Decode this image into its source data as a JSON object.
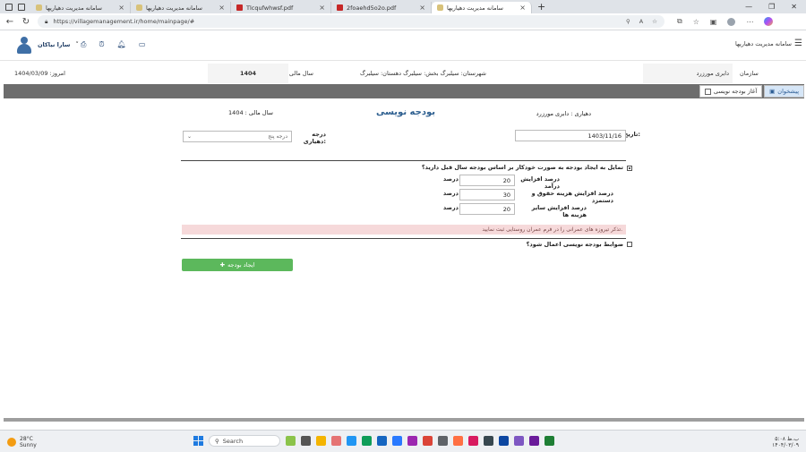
{
  "browser": {
    "tabs": [
      {
        "label": "سامانه مدیریت دهیاریها",
        "icon": "site",
        "active": false
      },
      {
        "label": "سامانه مدیریت دهیاریها",
        "icon": "site",
        "active": false
      },
      {
        "label": "Tlcqufwhwsf.pdf",
        "icon": "pdf",
        "active": false
      },
      {
        "label": "2foaehd5o2o.pdf",
        "icon": "pdf",
        "active": false
      },
      {
        "label": "سامانه مدیریت دهیاریها",
        "icon": "site",
        "active": true
      }
    ],
    "url": "https://villagemanagement.ir/home/mainpage/#"
  },
  "header": {
    "app_title": "سامانه مدیریت دهیاریها",
    "user_name": "سارا نیاکان"
  },
  "info": {
    "org_label": "سازمان",
    "org_value": "دابری مورزرد",
    "location": "شهرستان: سیلبرگ بخش: سیلبرگ دهستان: سیلبرگ",
    "fiscal_label": "سال مالی",
    "fiscal_value": "1404",
    "today": "امروز: 1404/03/09"
  },
  "tabs": {
    "pishkhan": "پیشخوان",
    "budget_start": "آغاز بودجه نویسی"
  },
  "form": {
    "heading": "بودجه نویسی",
    "dehyari": "دهیاری : دابری مورزرد",
    "fiscal": "سال مالی : 1404",
    "date_label": "تاریخ:",
    "date_value": "1403/11/16",
    "grade_label": "درجه دهیاری:",
    "grade_value": "درجه پنج",
    "auto_question": "تمایل به ایجاد بودجه به صورت خودکار بر اساس بودجه سال قبل دارید؟",
    "rows": [
      {
        "label": "درصد افزایش درآمد",
        "value": "20",
        "unit": "درصد"
      },
      {
        "label": "درصد افزایش هزینه حقوق و دستمزد",
        "value": "30",
        "unit": "درصد"
      },
      {
        "label": "درصد افزایش سایر هزینه ها",
        "value": "20",
        "unit": "درصد"
      }
    ],
    "notice": "تذکر تیروزه های عمرانی را در فرم عمران روستایی ثبت نمایید.",
    "rules_question": "ضوابط بودجه نویسی اعمال شود؟",
    "create_button": "ایجاد بودجه"
  },
  "taskbar": {
    "weather_temp": "28°C",
    "weather_desc": "Sunny",
    "search": "Search",
    "time": "۵:۰۸ ب.ظ",
    "date": "۱۴۰۴/۰۳/۰۹"
  }
}
